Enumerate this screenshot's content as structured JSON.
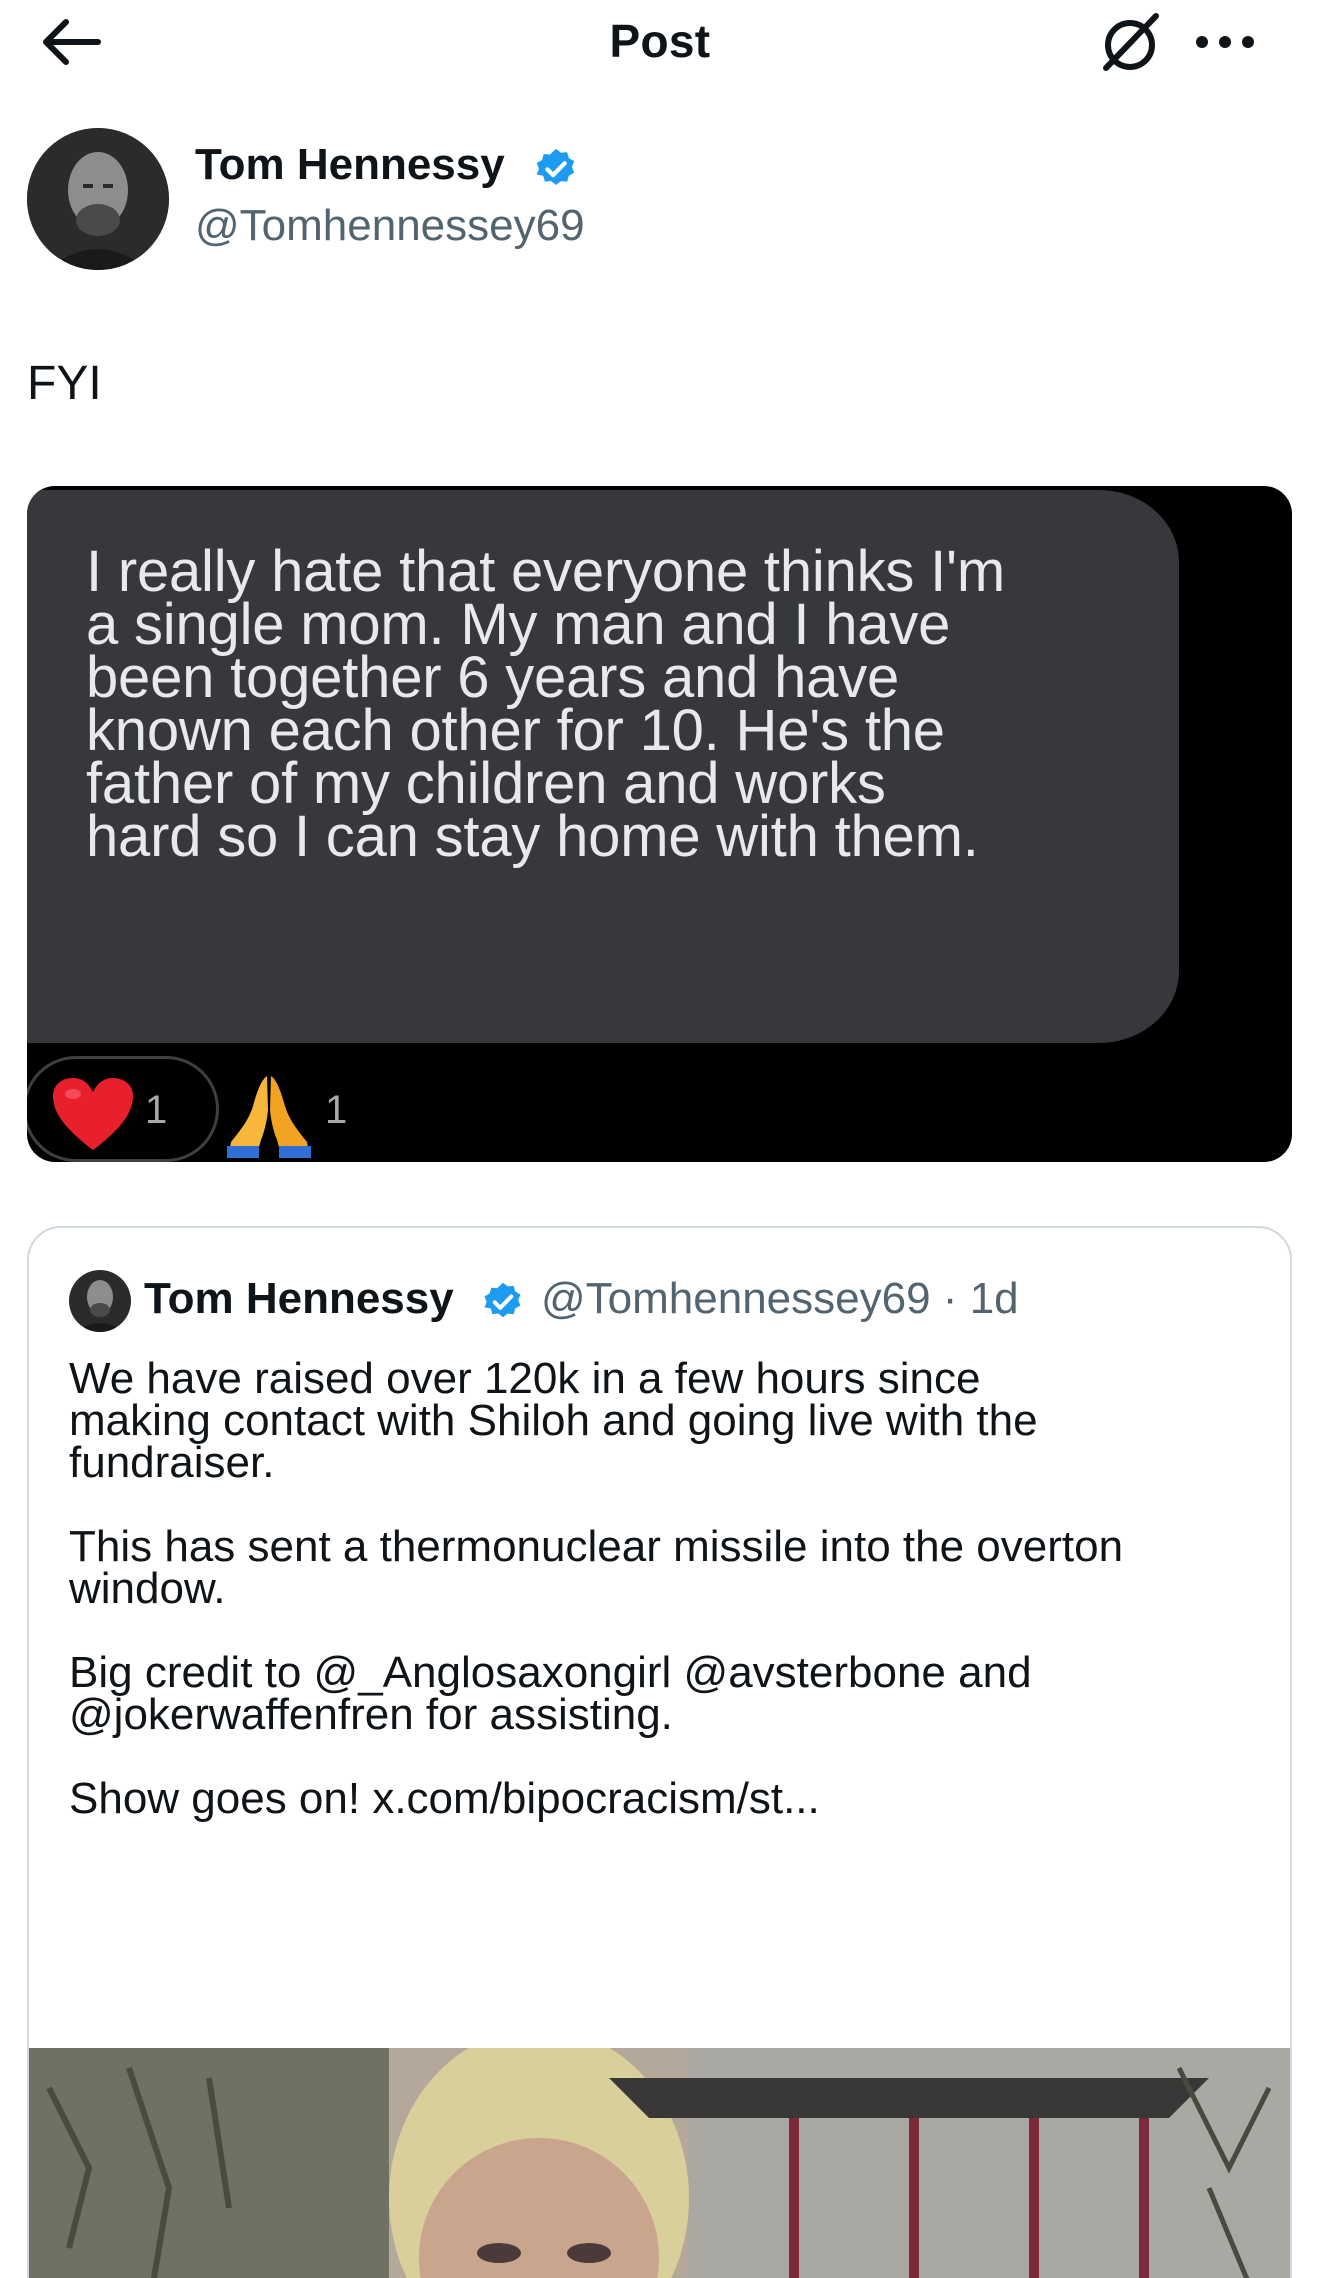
{
  "header": {
    "title": "Post"
  },
  "author": {
    "name": "Tom Hennessy",
    "handle": "@Tomhennessey69",
    "verified": true
  },
  "post": {
    "text": "FYI"
  },
  "embedded_screenshot": {
    "lines": [
      "I really hate that everyone thinks I'm",
      "a single mom. My man and I have",
      "been together 6 years and have",
      "known each other for 10. He's the",
      "father of my children and works",
      "hard so I can stay home with them."
    ],
    "reactions": [
      {
        "icon": "heart-emoji-icon",
        "count": "1"
      },
      {
        "icon": "praying-hands-emoji-icon",
        "count": "1"
      }
    ]
  },
  "quote": {
    "name": "Tom Hennessy",
    "handle": "@Tomhennessey69",
    "separator": "·",
    "time": "1d",
    "lines": [
      "We have raised over 120k in a few hours since",
      "making contact with Shiloh and going live with the",
      "fundraiser.",
      "This has sent a thermonuclear missile into the overton",
      "window.",
      "Big credit to @_Anglosaxongirl @avsterbone and",
      "@jokerwaffenfren for assisting.",
      "Show goes on! x.com/bipocracism/st..."
    ]
  },
  "colors": {
    "verified_blue": "#1d9bf0",
    "text_primary": "#0f1419",
    "text_secondary": "#536471",
    "bubble_bg": "#36383b",
    "card_border": "#cfd9de"
  }
}
